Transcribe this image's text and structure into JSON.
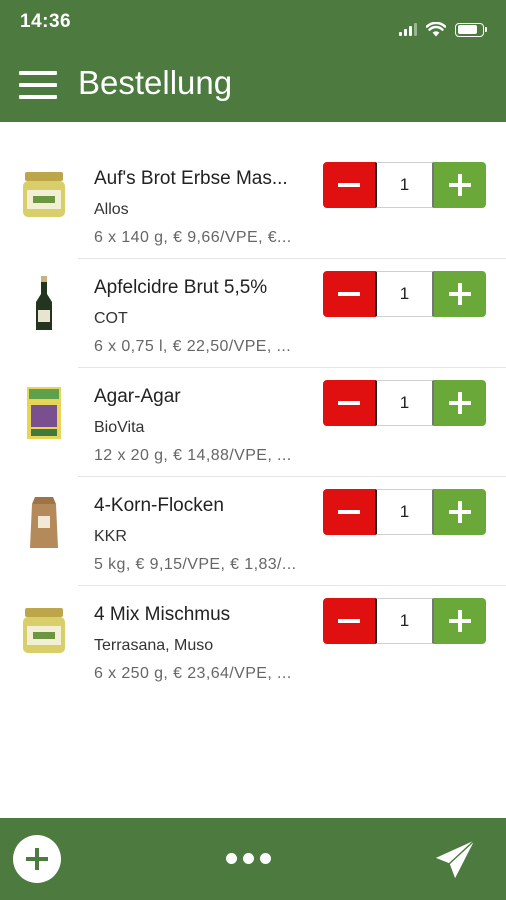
{
  "status_bar": {
    "time": "14:36",
    "battery_level": 0.8
  },
  "header": {
    "title": "Bestellung"
  },
  "colors": {
    "primary": "#4c7a3f",
    "minus": "#e01010",
    "plus": "#6aa83a"
  },
  "items": [
    {
      "name": "Auf's Brot Erbse Mas...",
      "brand": "Allos",
      "details": "6 x 140 g, € 9,66/VPE, €...",
      "quantity": "1",
      "thumb_icon": "glass-jar-icon"
    },
    {
      "name": "Apfelcidre Brut 5,5%",
      "brand": "COT",
      "details": "6 x 0,75 l, € 22,50/VPE, ...",
      "quantity": "1",
      "thumb_icon": "bottle-icon"
    },
    {
      "name": "Agar-Agar",
      "brand": "BioVita",
      "details": "12 x 20 g, € 14,88/VPE, ...",
      "quantity": "1",
      "thumb_icon": "box-package-icon"
    },
    {
      "name": "4-Korn-Flocken",
      "brand": "KKR",
      "details": "5 kg, € 9,15/VPE, € 1,83/...",
      "quantity": "1",
      "thumb_icon": "paper-bag-icon"
    },
    {
      "name": "4 Mix Mischmus",
      "brand": "Terrasana, Muso",
      "details": "6 x 250 g, € 23,64/VPE, ...",
      "quantity": "1",
      "thumb_icon": "glass-jar-icon"
    }
  ],
  "bottom_bar": {
    "add_icon": "plus-circle-icon",
    "more_icon": "more-dots-icon",
    "send_icon": "paper-plane-icon"
  }
}
